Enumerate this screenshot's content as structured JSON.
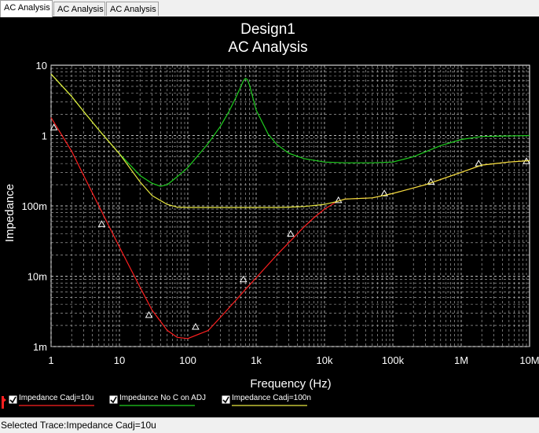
{
  "tabs": [
    {
      "label": "AC Analysis",
      "active": true
    },
    {
      "label": "AC Analysis",
      "active": false
    },
    {
      "label": "AC Analysis",
      "active": false
    }
  ],
  "chart_data": {
    "type": "line",
    "title": "Design1",
    "subtitle": "AC Analysis",
    "xlabel": "Frequency (Hz)",
    "ylabel": "Impedance",
    "xscale": "log",
    "yscale": "log",
    "xlim": [
      1,
      10000000
    ],
    "ylim": [
      0.001,
      10
    ],
    "xticks": [
      {
        "value": 1,
        "label": "1"
      },
      {
        "value": 10,
        "label": "10"
      },
      {
        "value": 100,
        "label": "100"
      },
      {
        "value": 1000,
        "label": "1k"
      },
      {
        "value": 10000,
        "label": "10k"
      },
      {
        "value": 100000,
        "label": "100k"
      },
      {
        "value": 1000000,
        "label": "1M"
      },
      {
        "value": 10000000,
        "label": "10M"
      }
    ],
    "yticks": [
      {
        "value": 10,
        "label": "10"
      },
      {
        "value": 1,
        "label": "1"
      },
      {
        "value": 0.1,
        "label": "100m"
      },
      {
        "value": 0.01,
        "label": "10m"
      },
      {
        "value": 0.001,
        "label": "1m"
      }
    ],
    "grid": true,
    "legend_position": "bottom",
    "series": [
      {
        "name": "Impedance Cadj=10u",
        "color": "#ff2020",
        "marker": "triangle",
        "x": [
          1,
          2,
          3,
          5,
          8,
          10,
          20,
          30,
          50,
          70,
          100,
          200,
          300,
          500,
          700,
          1000,
          2000,
          3000,
          5000,
          7000,
          10000,
          15000,
          20000,
          50000,
          100000,
          300000,
          1000000,
          2000000,
          5000000,
          10000000
        ],
        "y": [
          1.8,
          0.6,
          0.27,
          0.1,
          0.04,
          0.026,
          0.007,
          0.0033,
          0.0017,
          0.00135,
          0.0013,
          0.0017,
          0.0026,
          0.0045,
          0.0065,
          0.0095,
          0.02,
          0.03,
          0.05,
          0.068,
          0.09,
          0.115,
          0.125,
          0.13,
          0.15,
          0.2,
          0.3,
          0.38,
          0.42,
          0.44
        ],
        "markers_x": [
          1.1,
          5.5,
          27,
          130,
          650,
          3200,
          16000,
          75000,
          360000,
          1800000,
          9000000
        ],
        "markers_y": [
          1.3,
          0.055,
          0.0028,
          0.0019,
          0.009,
          0.04,
          0.12,
          0.15,
          0.22,
          0.4,
          0.43
        ]
      },
      {
        "name": "Impedance No C on ADJ",
        "color": "#20d020",
        "x": [
          1,
          2,
          3,
          5,
          10,
          20,
          30,
          40,
          50,
          70,
          100,
          200,
          300,
          400,
          500,
          600,
          650,
          700,
          750,
          800,
          900,
          1000,
          1500,
          2000,
          3000,
          5000,
          10000,
          20000,
          50000,
          100000,
          200000,
          500000,
          1000000,
          2000000,
          10000000
        ],
        "y": [
          7.5,
          3.6,
          2.2,
          1.2,
          0.55,
          0.27,
          0.21,
          0.19,
          0.2,
          0.26,
          0.35,
          0.78,
          1.35,
          2.2,
          3.4,
          5.0,
          6.0,
          6.5,
          6.2,
          5.2,
          3.4,
          2.3,
          1.05,
          0.75,
          0.56,
          0.47,
          0.42,
          0.41,
          0.41,
          0.42,
          0.5,
          0.72,
          0.88,
          0.97,
          1.0
        ]
      },
      {
        "name": "Impedance Cadj=100n",
        "color": "#e8e840",
        "x": [
          1,
          2,
          3,
          5,
          10,
          20,
          30,
          50,
          70,
          100,
          200,
          500,
          1000,
          2000,
          3000,
          5000,
          10000,
          15000,
          20000,
          50000,
          100000,
          300000,
          1000000,
          2000000,
          5000000,
          10000000
        ],
        "y": [
          7.5,
          3.6,
          2.2,
          1.2,
          0.55,
          0.22,
          0.14,
          0.105,
          0.096,
          0.095,
          0.095,
          0.095,
          0.095,
          0.095,
          0.096,
          0.098,
          0.105,
          0.115,
          0.125,
          0.13,
          0.15,
          0.2,
          0.3,
          0.38,
          0.42,
          0.44
        ]
      }
    ]
  },
  "status": {
    "selected_trace": "Selected Trace:Impedance Cadj=10u"
  }
}
